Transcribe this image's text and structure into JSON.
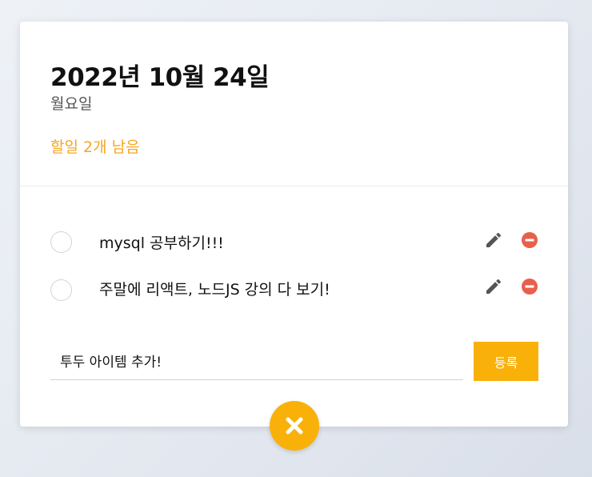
{
  "header": {
    "date": "2022년 10월 24일",
    "weekday": "월요일",
    "remaining": "할일 2개 남음"
  },
  "todos": [
    {
      "text": "mysql 공부하기!!!",
      "done": false
    },
    {
      "text": "주말에 리액트, 노드JS 강의 다 보기!",
      "done": false
    }
  ],
  "input": {
    "value": "투두 아이템 추가!",
    "placeholder": ""
  },
  "submit": {
    "label": "등록"
  },
  "icons": {
    "edit": "pencil-icon",
    "delete": "minus-circle-icon",
    "close": "close-icon"
  },
  "colors": {
    "accent": "#f9b10a",
    "remaining_text": "#f5a623",
    "delete": "#e8604c",
    "edit": "#555555"
  }
}
